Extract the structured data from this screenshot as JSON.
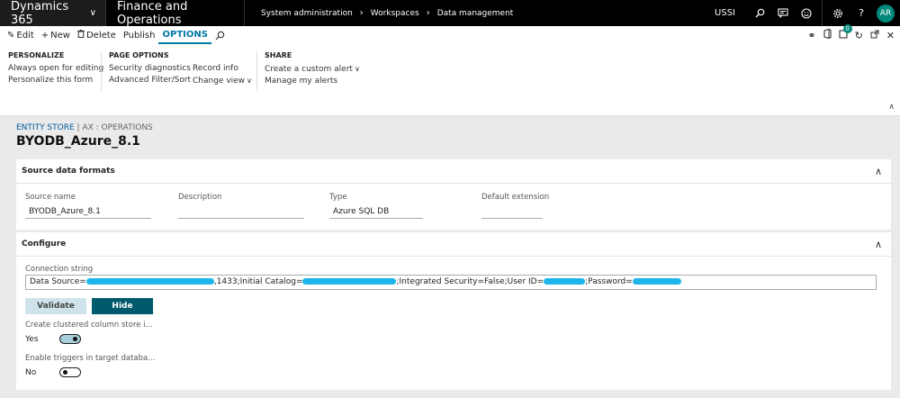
{
  "topbar": {
    "app": "Dynamics 365",
    "module": "Finance and Operations",
    "breadcrumb": [
      "System administration",
      "Workspaces",
      "Data management"
    ],
    "company": "USSI",
    "avatar": "AR"
  },
  "actionbar": {
    "edit": "Edit",
    "new": "New",
    "delete": "Delete",
    "publish": "Publish",
    "options": "OPTIONS",
    "badge_count": "0"
  },
  "ribbon": {
    "personalize": {
      "title": "PERSONALIZE",
      "items": [
        "Always open for editing",
        "Personalize this form"
      ]
    },
    "page_options": {
      "title": "PAGE OPTIONS",
      "items": [
        "Security diagnostics",
        "Advanced Filter/Sort"
      ],
      "items2": [
        "Record info",
        "Change view"
      ]
    },
    "share": {
      "title": "SHARE",
      "items": [
        "Create a custom alert",
        "Manage my alerts"
      ]
    }
  },
  "header": {
    "entity": "ENTITY STORE",
    "separator": "|",
    "context": "AX : OPERATIONS",
    "title": "BYODB_Azure_8.1"
  },
  "source": {
    "heading": "Source data formats",
    "name_label": "Source name",
    "name_value": "BYODB_Azure_8.1",
    "desc_label": "Description",
    "desc_value": "",
    "type_label": "Type",
    "type_value": "Azure SQL DB",
    "ext_label": "Default extension",
    "ext_value": ""
  },
  "configure": {
    "heading": "Configure",
    "conn_label": "Connection string",
    "conn_parts": [
      "Data Source=",
      ",1433;Initial Catalog=",
      ";Integrated Security=False;User ID=",
      ";Password="
    ],
    "validate": "Validate",
    "hide": "Hide",
    "clustered_label": "Create clustered column store i...",
    "clustered_value": "Yes",
    "triggers_label": "Enable triggers in target databa...",
    "triggers_value": "No"
  }
}
